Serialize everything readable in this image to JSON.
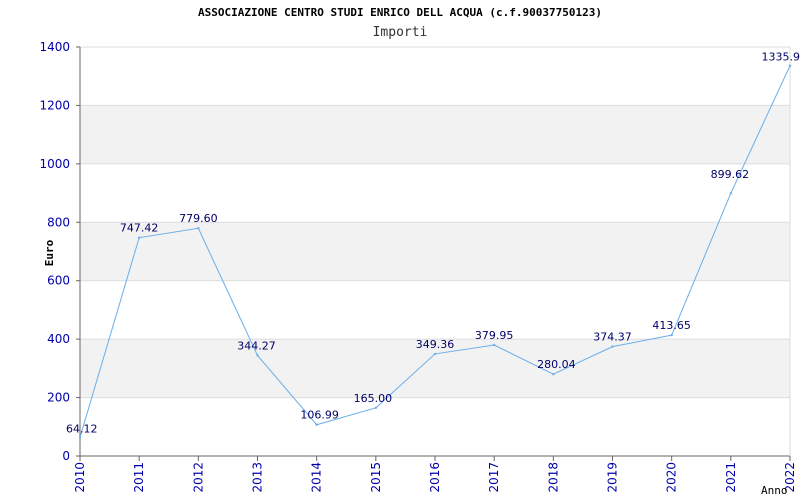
{
  "chart_data": {
    "type": "line",
    "title": "ASSOCIAZIONE CENTRO STUDI ENRICO DELL ACQUA (c.f.90037750123)",
    "subtitle": "Importi",
    "xlabel": "Anno",
    "ylabel": "Euro",
    "categories": [
      "2010",
      "2011",
      "2012",
      "2013",
      "2014",
      "2015",
      "2016",
      "2017",
      "2018",
      "2019",
      "2020",
      "2021",
      "2022"
    ],
    "values": [
      64.12,
      747.42,
      779.6,
      344.27,
      106.99,
      165.0,
      349.36,
      379.95,
      280.04,
      374.37,
      413.65,
      899.62,
      1335.9
    ],
    "data_labels": [
      "64.12",
      "747.42",
      "779.60",
      "344.27",
      "106.99",
      "165.00",
      "349.36",
      "379.95",
      "280.04",
      "374.37",
      "413.65",
      "899.62",
      "1335.9"
    ],
    "ylim": [
      0,
      1400
    ],
    "yticks": [
      "0",
      "200",
      "400",
      "600",
      "800",
      "1000",
      "1200",
      "1400"
    ],
    "grid": "horizontal alternating bands",
    "colors": {
      "line": "#6aaeea",
      "band": "#f2f2f2",
      "tick": "#0000aa",
      "label": "#000066"
    }
  }
}
